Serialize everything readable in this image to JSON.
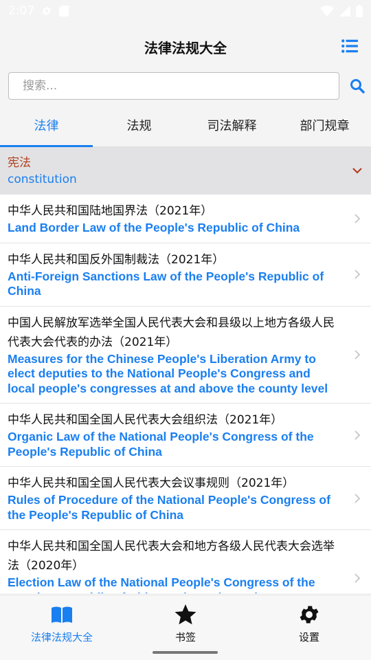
{
  "status_bar": {
    "time": "2:07"
  },
  "header": {
    "title": "法律法规大全"
  },
  "search": {
    "placeholder": "搜索..."
  },
  "tabs": [
    {
      "label": "法律",
      "active": true
    },
    {
      "label": "法规",
      "active": false
    },
    {
      "label": "司法解释",
      "active": false
    },
    {
      "label": "部门规章",
      "active": false
    }
  ],
  "category": {
    "title_cn": "宪法",
    "title_en": "constitution",
    "expanded": true
  },
  "laws": [
    {
      "cn": "中华人民共和国陆地国界法（2021年）",
      "en": "Land Border Law of the People's Republic of China"
    },
    {
      "cn": "中华人民共和国反外国制裁法（2021年）",
      "en": "Anti-Foreign Sanctions Law of the People's Republic of China"
    },
    {
      "cn": "中国人民解放军选举全国人民代表大会和县级以上地方各级人民代表大会代表的办法（2021年）",
      "en": "Measures for the Chinese People's Liberation Army to elect deputies to the National People's Congress and local people's congresses at and above the county level"
    },
    {
      "cn": "中华人民共和国全国人民代表大会组织法（2021年）",
      "en": "Organic Law of the National People's Congress of the People's Republic of China"
    },
    {
      "cn": "中华人民共和国全国人民代表大会议事规则（2021年）",
      "en": "Rules of Procedure of the National People's Congress of the People's Republic of China"
    },
    {
      "cn": "中华人民共和国全国人民代表大会和地方各级人民代表大会选举法（2020年）",
      "en": "Election Law of the National People's Congress of the People's Republic of China and Local People's Congresses"
    }
  ],
  "bottom_nav": [
    {
      "label": "法律法规大全",
      "icon": "book-icon",
      "active": true
    },
    {
      "label": "书签",
      "icon": "star-icon",
      "active": false
    },
    {
      "label": "设置",
      "icon": "gear-icon",
      "active": false
    }
  ],
  "colors": {
    "accent": "#1a7ff0",
    "category_text": "#b0401e",
    "category_bg": "#e2e2e4"
  }
}
